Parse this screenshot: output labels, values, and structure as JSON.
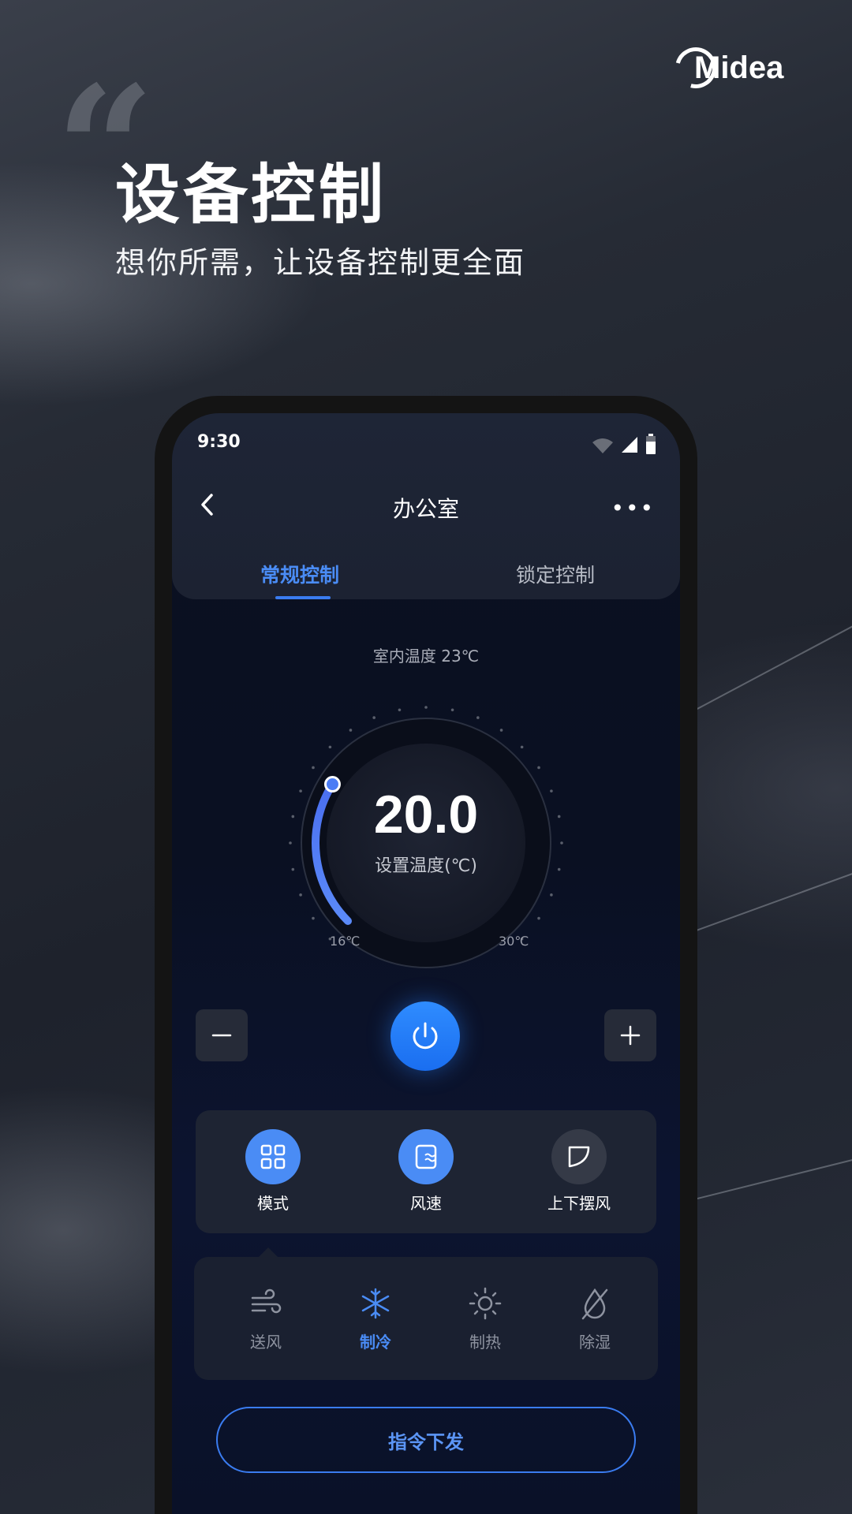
{
  "brand": {
    "logo_text": "Midea"
  },
  "hero": {
    "title": "设备控制",
    "subtitle": "想你所需，让设备控制更全面"
  },
  "phone": {
    "status_time": "9:30",
    "nav_title": "办公室",
    "tabs": [
      {
        "label": "常规控制",
        "active": true
      },
      {
        "label": "锁定控制",
        "active": false
      }
    ],
    "indoor_temp": "室内温度 23℃",
    "set_temp_value": "20.0",
    "set_temp_label": "设置温度(℃)",
    "dial_min": "16℃",
    "dial_max": "30℃",
    "functions": [
      {
        "label": "模式",
        "icon": "grid-icon",
        "active": true
      },
      {
        "label": "风速",
        "icon": "fan-speed-icon",
        "active": true
      },
      {
        "label": "上下摆风",
        "icon": "swing-icon",
        "active": false
      }
    ],
    "modes": [
      {
        "label": "送风",
        "icon": "wind-icon",
        "active": false
      },
      {
        "label": "制冷",
        "icon": "snowflake-icon",
        "active": true
      },
      {
        "label": "制热",
        "icon": "sun-icon",
        "active": false
      },
      {
        "label": "除湿",
        "icon": "dehumidify-icon",
        "active": false
      }
    ],
    "send_button": "指令下发"
  },
  "colors": {
    "accent": "#3a7cf0",
    "power": "#1a6ef0"
  }
}
